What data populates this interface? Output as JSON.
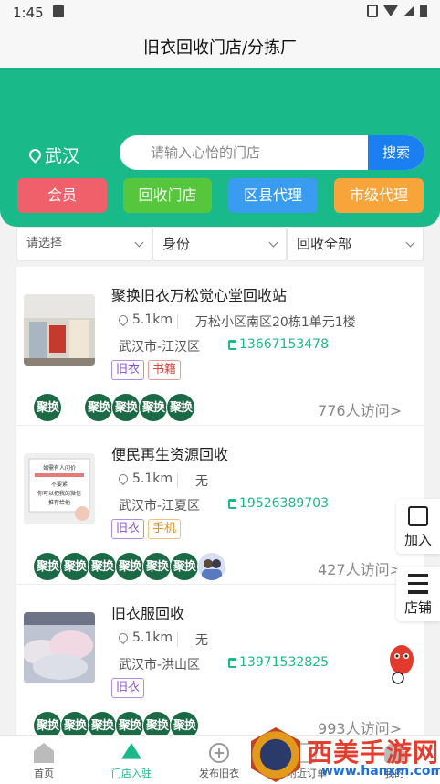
{
  "status_bar": {
    "time": "1:45"
  },
  "header": {
    "title": "旧衣回收门店/分拣厂"
  },
  "location": {
    "city": "武汉"
  },
  "search": {
    "placeholder": "请输入心怡的门店",
    "button": "搜索"
  },
  "categories": [
    {
      "label": "会员",
      "color": "#f0606a"
    },
    {
      "label": "回收门店",
      "color": "#56c73c"
    },
    {
      "label": "区县代理",
      "color": "#3a9cf0"
    },
    {
      "label": "市级代理",
      "color": "#f7a43a"
    }
  ],
  "filters": [
    {
      "label": "请选择"
    },
    {
      "label": "身份"
    },
    {
      "label": "回收全部"
    }
  ],
  "stores": [
    {
      "name": "聚换旧衣万松觉心堂回收站",
      "distance": "5.1km",
      "address": "万松小区南区20栋1单元1楼",
      "region": "武汉市-江汉区",
      "phone": "13667153478",
      "tags": [
        "旧衣",
        "书籍"
      ],
      "badges": [
        "聚换",
        "聚换",
        "聚换",
        "聚换",
        "聚换",
        "聚换"
      ],
      "visits": "776人访问>"
    },
    {
      "name": "便民再生资源回收",
      "distance": "5.1km",
      "address": "无",
      "region": "武汉市-江夏区",
      "phone": "19526389703",
      "tags": [
        "旧衣",
        "手机"
      ],
      "badges": [
        "聚换",
        "聚换",
        "聚换",
        "聚换",
        "聚换",
        "聚换"
      ],
      "visits": "427人访问>"
    },
    {
      "name": "旧衣服回收",
      "distance": "5.1km",
      "address": "无",
      "region": "武汉市-洪山区",
      "phone": "13971532825",
      "tags": [
        "旧衣"
      ],
      "badges": [
        "聚换",
        "聚换",
        "聚换",
        "聚换",
        "聚换",
        "聚换"
      ],
      "visits": "993人访问>"
    }
  ],
  "thumb2_text": {
    "l1": "如需有人问价",
    "l2": "你可以把我的微信",
    "l3": "不要紧",
    "l4": "推荐给他"
  },
  "float_buttons": {
    "join": "加入",
    "shop": "店铺"
  },
  "tabs": [
    {
      "label": "首页"
    },
    {
      "label": "门店入驻"
    },
    {
      "label": "发布旧衣"
    },
    {
      "label": "附近订单"
    },
    {
      "label": "我的"
    }
  ],
  "watermark": {
    "title": "西美手游网",
    "url": "www.hanxm.com"
  }
}
